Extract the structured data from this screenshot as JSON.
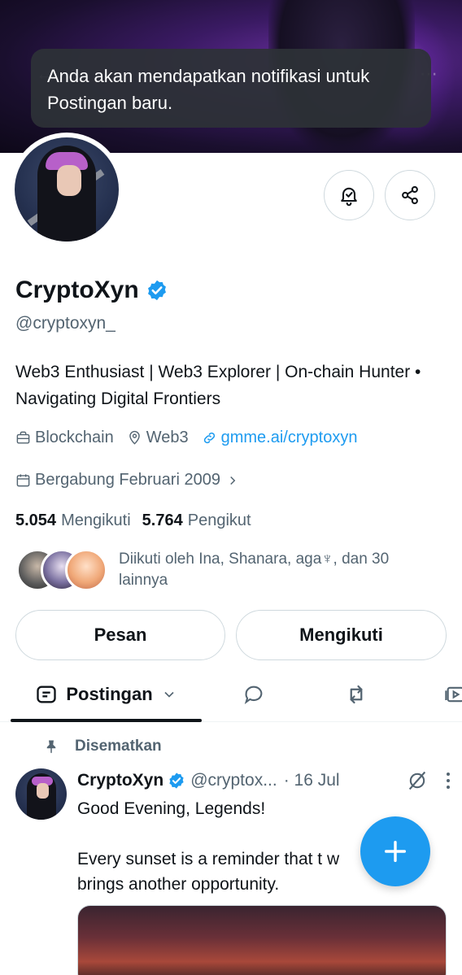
{
  "toast": {
    "message": "Anda akan mendapatkan notifikasi untuk Postingan baru."
  },
  "profile": {
    "name": "CryptoXyn",
    "handle": "@cryptoxyn_",
    "bio": "Web3 Enthusiast | Web3 Explorer | On-chain Hunter • Navigating Digital Frontiers",
    "category": "Blockchain",
    "location": "Web3",
    "website": "gmme.ai/cryptoxyn",
    "joined": "Bergabung Februari 2009"
  },
  "stats": {
    "following_count": "5.054",
    "following_label": "Mengikuti",
    "followers_count": "5.764",
    "followers_label": "Pengikut"
  },
  "followed_by": "Diikuti oleh Ina, Shanara, aga♆, dan 30 lainnya",
  "actions": {
    "message_label": "Pesan",
    "following_label": "Mengikuti"
  },
  "tabs": {
    "posts_label": "Postingan"
  },
  "pinned_post": {
    "pinned_label": "Disematkan",
    "author_name": "CryptoXyn",
    "author_handle": "@cryptox...",
    "date": "· 16 Jul",
    "text": "Good Evening, Legends!\n\nEvery sunset is a reminder that t          w\nbrings another opportunity."
  },
  "colors": {
    "accent": "#1d9bf0",
    "text_primary": "#0f1419",
    "text_secondary": "#536471",
    "border": "#cfd9de"
  }
}
